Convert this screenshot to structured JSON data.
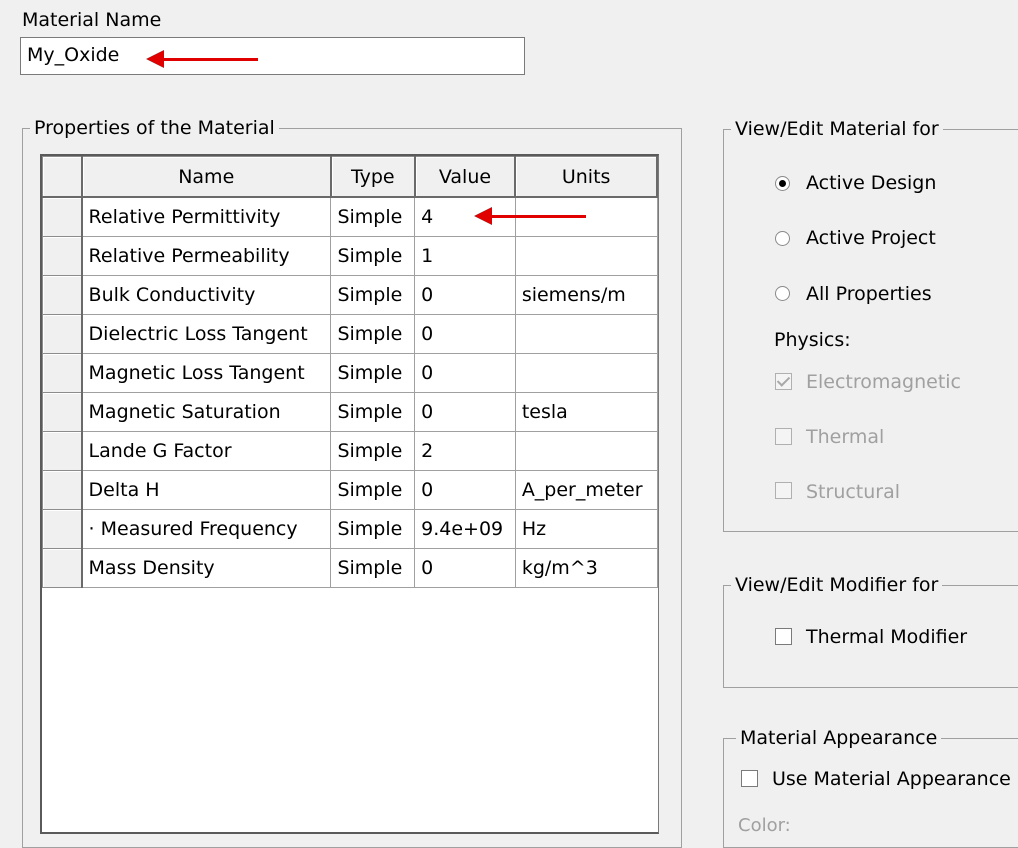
{
  "material_name": {
    "label": "Material Name",
    "value": "My_Oxide"
  },
  "properties": {
    "title": "Properties of the Material",
    "columns": [
      "Name",
      "Type",
      "Value",
      "Units"
    ],
    "rows": [
      {
        "name": "Relative Permittivity",
        "type": "Simple",
        "value": "4",
        "units": ""
      },
      {
        "name": "Relative Permeability",
        "type": "Simple",
        "value": "1",
        "units": ""
      },
      {
        "name": "Bulk Conductivity",
        "type": "Simple",
        "value": "0",
        "units": "siemens/m"
      },
      {
        "name": "Dielectric Loss Tangent",
        "type": "Simple",
        "value": "0",
        "units": ""
      },
      {
        "name": "Magnetic Loss Tangent",
        "type": "Simple",
        "value": "0",
        "units": ""
      },
      {
        "name": "Magnetic Saturation",
        "type": "Simple",
        "value": "0",
        "units": "tesla"
      },
      {
        "name": "Lande G Factor",
        "type": "Simple",
        "value": "2",
        "units": ""
      },
      {
        "name": "Delta H",
        "type": "Simple",
        "value": "0",
        "units": "A_per_meter"
      },
      {
        "name": "·  Measured Frequency",
        "type": "Simple",
        "value": "9.4e+09",
        "units": "Hz"
      },
      {
        "name": "Mass Density",
        "type": "Simple",
        "value": "0",
        "units": "kg/m^3"
      }
    ]
  },
  "view_edit_material": {
    "title": "View/Edit Material for",
    "options": [
      "Active Design",
      "Active Project",
      "All Properties"
    ],
    "selected": "Active Design",
    "physics_label": "Physics:",
    "physics": [
      {
        "label": "Electromagnetic",
        "checked": true
      },
      {
        "label": "Thermal",
        "checked": false
      },
      {
        "label": "Structural",
        "checked": false
      }
    ]
  },
  "view_edit_modifier": {
    "title": "View/Edit Modifier for",
    "thermal_modifier": "Thermal Modifier"
  },
  "material_appearance": {
    "title": "Material Appearance",
    "use_appearance": "Use Material Appearance",
    "color_label": "Color:"
  },
  "annotation_color": "#e00000"
}
